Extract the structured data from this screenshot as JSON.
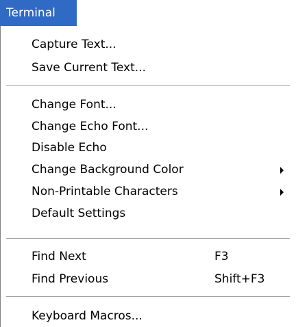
{
  "menu": {
    "title": "Terminal",
    "groups": [
      {
        "items": [
          {
            "label": "Capture Text..."
          },
          {
            "label": "Save Current Text..."
          }
        ]
      },
      {
        "items": [
          {
            "label": "Change Font..."
          },
          {
            "label": "Change Echo Font..."
          },
          {
            "label": "Disable Echo"
          },
          {
            "label": "Change Background Color",
            "submenu": true
          },
          {
            "label": "Non-Printable Characters",
            "submenu": true
          },
          {
            "label": "Default Settings"
          }
        ]
      },
      {
        "items": [
          {
            "label": "Find Next",
            "shortcut": "F3"
          },
          {
            "label": "Find Previous",
            "shortcut": "Shift+F3"
          }
        ]
      },
      {
        "items": [
          {
            "label": "Keyboard Macros..."
          }
        ]
      }
    ]
  },
  "colors": {
    "menu_title_bg": "#316ac5",
    "menu_title_text": "#ffffff",
    "menu_bg": "#ffffff",
    "separator": "#a0a0a0"
  },
  "icons": {
    "submenu": "submenu-arrow-icon"
  }
}
